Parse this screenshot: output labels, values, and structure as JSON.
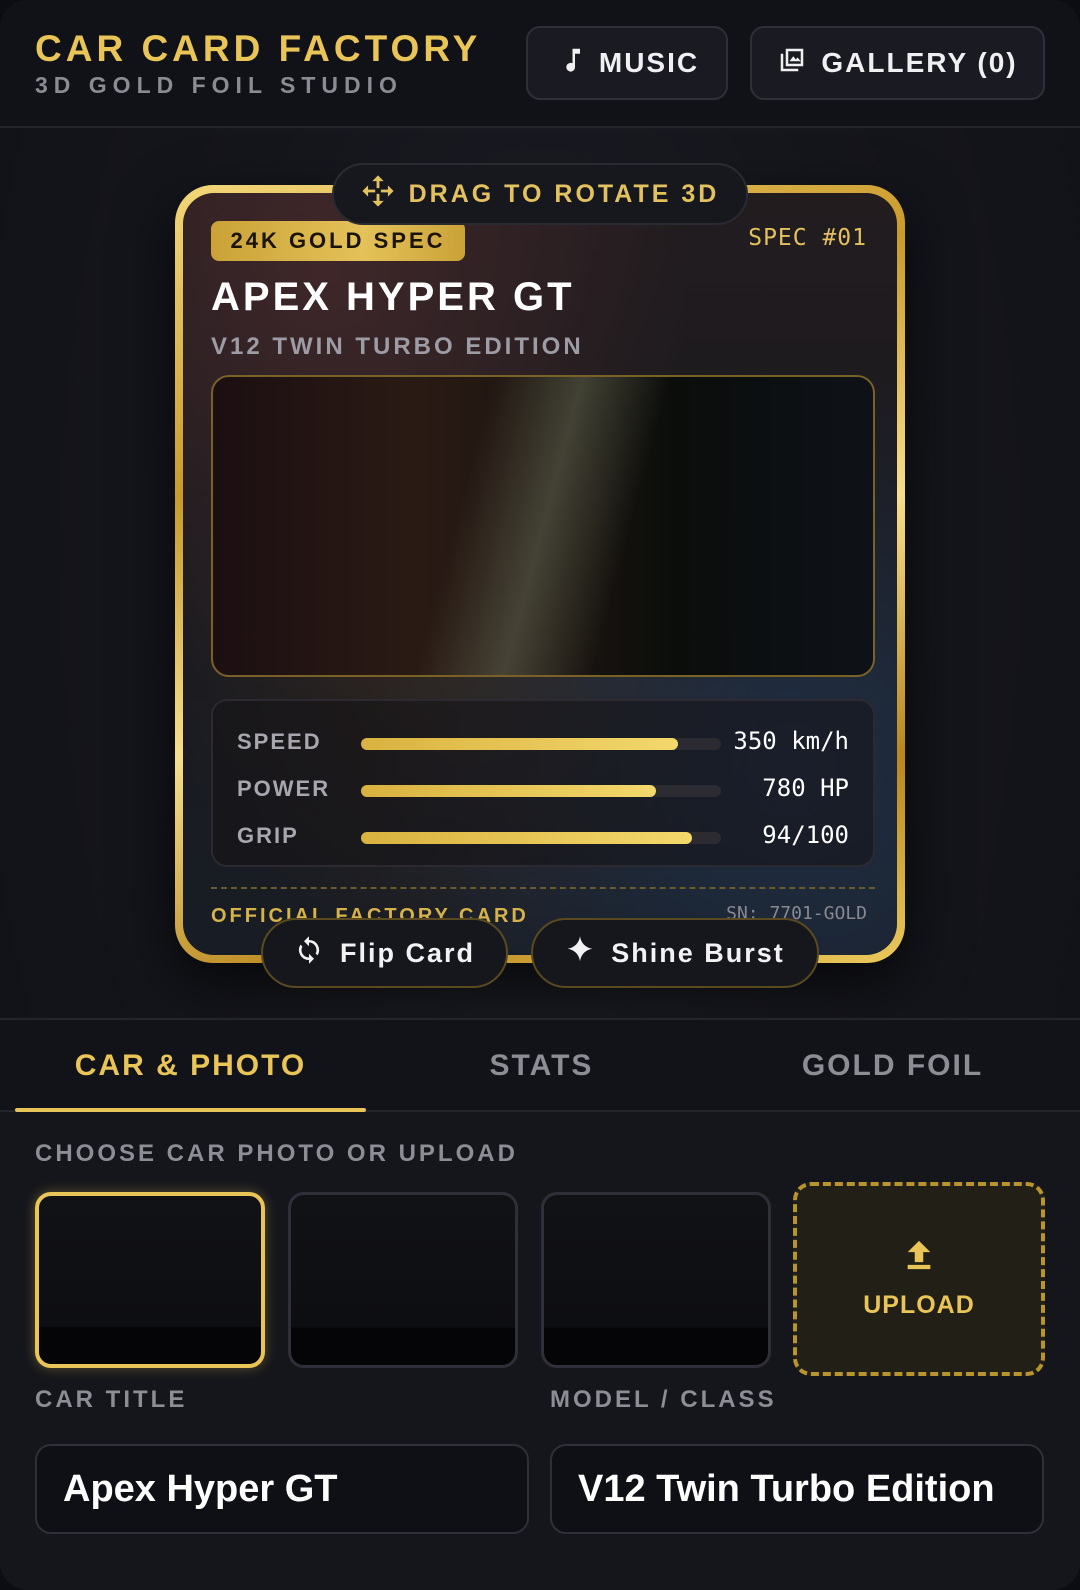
{
  "header": {
    "title": "CAR CARD FACTORY",
    "subtitle": "3D GOLD FOIL STUDIO",
    "music_label": "MUSIC",
    "gallery_label": "GALLERY (0)"
  },
  "stage": {
    "drag_hint": "DRAG TO ROTATE 3D",
    "flip_label": "Flip Card",
    "shine_label": "Shine Burst"
  },
  "card": {
    "badge": "24K GOLD SPEC",
    "spec_number": "SPEC #01",
    "title": "APEX HYPER GT",
    "model": "V12 TWIN TURBO EDITION",
    "stats": [
      {
        "label": "SPEED",
        "value": "350 km/h",
        "fill": 0.88
      },
      {
        "label": "POWER",
        "value": "780 HP",
        "fill": 0.82
      },
      {
        "label": "GRIP",
        "value": "94/100",
        "fill": 0.92
      }
    ],
    "footer_left": "OFFICIAL FACTORY CARD",
    "serial": "SN: 7701-GOLD"
  },
  "tabs": [
    {
      "label": "CAR & PHOTO",
      "active": true
    },
    {
      "label": "STATS",
      "active": false
    },
    {
      "label": "GOLD FOIL",
      "active": false
    }
  ],
  "panel": {
    "photo_section_label": "CHOOSE CAR PHOTO OR UPLOAD",
    "upload_label": "UPLOAD",
    "car_title_label": "CAR TITLE",
    "car_title_value": "Apex Hyper GT",
    "model_label": "MODEL / CLASS",
    "model_value": "V12 Twin Turbo Edition"
  },
  "colors": {
    "gold": "#e9c456",
    "background": "#15161c",
    "panel": "#121319"
  },
  "icons": {
    "music": "music-note-icon",
    "gallery": "gallery-icon",
    "drag": "move-arrows-icon",
    "flip": "refresh-icon",
    "shine": "sparkle-icon",
    "upload": "upload-arrow-icon"
  }
}
